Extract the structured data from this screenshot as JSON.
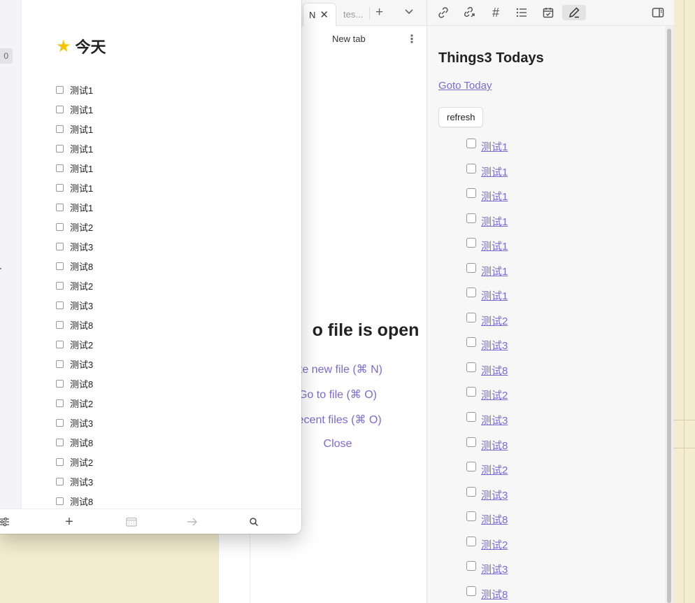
{
  "colors": {
    "accent": "#7c6bd0",
    "star": "#f5c400"
  },
  "floating_window": {
    "badge": "0",
    "heading": "今天",
    "heading_icon": "star-icon",
    "items": [
      "测试1",
      "测试1",
      "测试1",
      "测试1",
      "测试1",
      "测试1",
      "测试1",
      "测试2",
      "测试3",
      "测试8",
      "测试2",
      "测试3",
      "测试8",
      "测试2",
      "测试3",
      "测试8",
      "测试2",
      "测试3",
      "测试8",
      "测试2",
      "测试3",
      "测试8"
    ],
    "footer_icons": [
      "sliders-icon",
      "plus-icon",
      "calendar-icon",
      "arrow-right-icon",
      "search-icon"
    ]
  },
  "tabs": {
    "active_label": "N",
    "inactive_label": "tes...",
    "newtab_title": "New tab"
  },
  "empty_state": {
    "heading": "o file is open",
    "actions": [
      "ate new file (⌘ N)",
      "Go to file (⌘ O)",
      " recent files (⌘ O)",
      "Close"
    ]
  },
  "right_panel": {
    "toolbar_icons": [
      "link-icon",
      "link-out-icon",
      "hash-icon",
      "list-icon",
      "calendar-check-icon",
      "pen-icon",
      "sidebar-toggle-icon"
    ],
    "title": "Things3 Todays",
    "link": "Goto Today",
    "refresh": "refresh",
    "items": [
      "测试1",
      "测试1",
      "测试1",
      "测试1",
      "测试1",
      "测试1",
      "测试1",
      "测试2",
      "测试3",
      "测试8",
      "测试2",
      "测试3",
      "测试8",
      "测试2",
      "测试3",
      "测试8",
      "测试2",
      "测试3",
      "测试8"
    ]
  }
}
